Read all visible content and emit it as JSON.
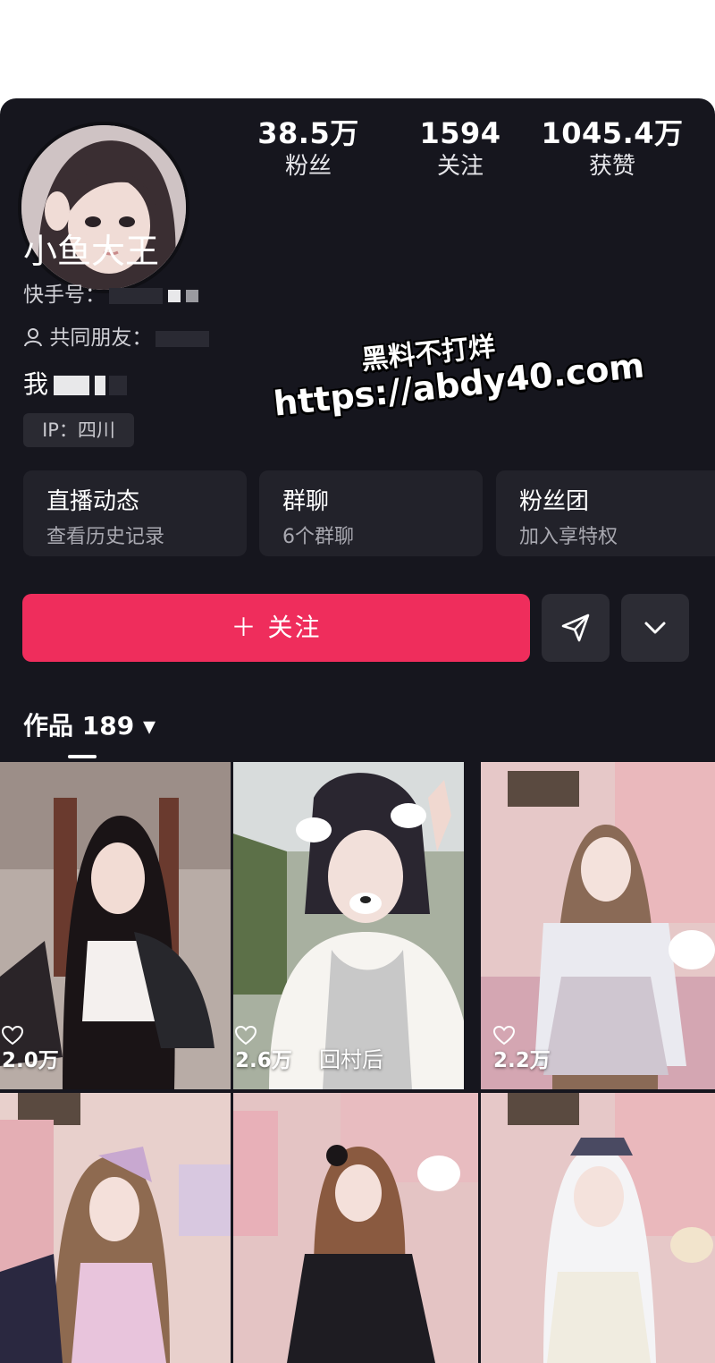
{
  "profile": {
    "name": "小鱼大王",
    "id_label": "快手号：",
    "mutual_label": "共同朋友：",
    "bio_prefix": "我",
    "ip": "IP：四川"
  },
  "stats": [
    {
      "value": "38.5万",
      "label": "粉丝"
    },
    {
      "value": "1594",
      "label": "关注"
    },
    {
      "value": "1045.4万",
      "label": "获赞"
    }
  ],
  "cards": [
    {
      "title": "直播动态",
      "subtitle": "查看历史记录"
    },
    {
      "title": "群聊",
      "subtitle": "6个群聊"
    },
    {
      "title": "粉丝团",
      "subtitle": "加入享特权"
    }
  ],
  "actions": {
    "follow_label": "＋ 关注"
  },
  "works_tab": {
    "label": "作品 189 ▾"
  },
  "watermark": {
    "line1": "黑料不打烊",
    "line2": "https://abdy40.com"
  },
  "videos": [
    {
      "likes": "2.0万",
      "caption": ""
    },
    {
      "likes": "2.6万",
      "caption": "回村后"
    },
    {
      "likes": "2.2万",
      "caption": ""
    },
    {
      "likes": "",
      "caption": ""
    },
    {
      "likes": "",
      "caption": ""
    },
    {
      "likes": "",
      "caption": ""
    }
  ],
  "colors": {
    "background": "#16161e",
    "accent": "#ef2d5c",
    "card": "#22222a"
  }
}
